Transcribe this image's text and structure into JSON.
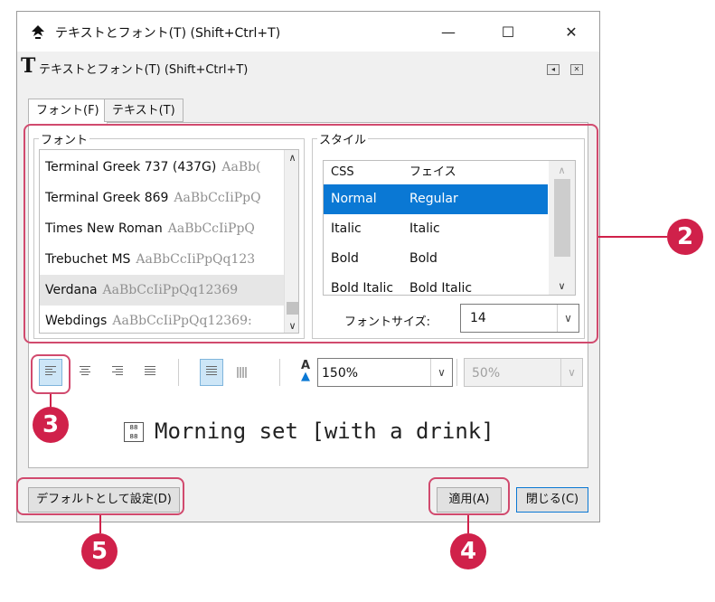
{
  "window": {
    "title": "テキストとフォント(T) (Shift+Ctrl+T)",
    "caption_min": "—",
    "caption_max": "☐",
    "caption_close": "✕"
  },
  "dock": {
    "glyph": "T",
    "title": "テキストとフォント(T) (Shift+Ctrl+T)"
  },
  "tabs": [
    {
      "label": "フォント(F)",
      "active": true
    },
    {
      "label": "テキスト(T)",
      "active": false
    }
  ],
  "font_group": {
    "label": "フォント",
    "fonts": [
      {
        "name": "Terminal Greek 737 (437G)",
        "sample": "AaBb("
      },
      {
        "name": "Terminal Greek 869",
        "sample": "AaBbCcIiPpQ"
      },
      {
        "name": "Times New Roman",
        "sample": "AaBbCcIiPpQ"
      },
      {
        "name": "Trebuchet MS",
        "sample": "AaBbCcIiPpQq123"
      },
      {
        "name": "Verdana",
        "sample": "AaBbCcIiPpQq12369"
      },
      {
        "name": "Webdings",
        "sample": "AaBbCcIiPpQq12369:"
      }
    ],
    "selected_index": 4
  },
  "style_group": {
    "label": "スタイル",
    "columns": [
      "CSS",
      "フェイス"
    ],
    "rows": [
      {
        "css": "Normal",
        "face": "Regular",
        "selected": true
      },
      {
        "css": "Italic",
        "face": "Italic",
        "selected": false
      },
      {
        "css": "Bold",
        "face": "Bold",
        "selected": false
      },
      {
        "css": "Bold Italic",
        "face": "Bold Italic",
        "selected": false
      }
    ],
    "size_label": "フォントサイズ:",
    "size_value": "14"
  },
  "toolbar": {
    "line_spacing": "150%",
    "kerning": "50%",
    "spacing_glyph": "A"
  },
  "preview": {
    "glyph": "88 88",
    "text": "Morning set [with a drink]"
  },
  "buttons": {
    "set_default": "デフォルトとして設定(D)",
    "apply": "適用(A)",
    "close": "閉じる(C)"
  },
  "callouts": [
    "2",
    "3",
    "4",
    "5"
  ],
  "colors": {
    "accent": "#0a78d4",
    "callout": "#d0214a",
    "highlight": "#d14a6e"
  }
}
